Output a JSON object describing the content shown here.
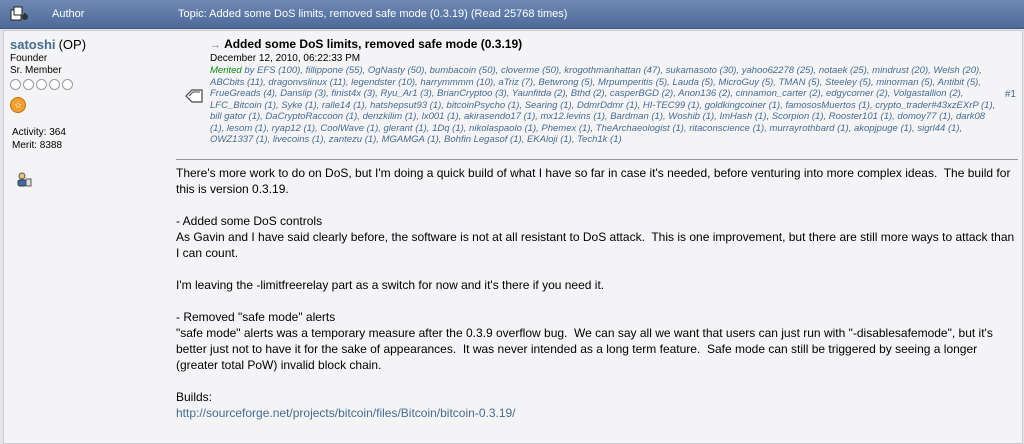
{
  "header": {
    "author_label": "Author",
    "topic_text": "Topic: Added some DoS limits, removed safe mode (0.3.19)  (Read 25768 times)"
  },
  "poster": {
    "name": "satoshi",
    "op": "(OP)",
    "title": "Founder",
    "rank": "Sr. Member",
    "activity": "Activity: 364",
    "merit": "Merit: 8388",
    "badge": "☆"
  },
  "post": {
    "arrow": "→",
    "subject": "Added some DoS limits, removed safe mode (0.3.19)",
    "date": "December 12, 2010, 06:22:33 PM",
    "merited_label": "Merited",
    "merited_by": " by EFS (100), fillippone (55), OgNasty (50), bumbacoin (50), cloverme (50), krogothmanhattan (47), sukamasoto (30), yahoo62278 (25), notaek (25), mindrust (20), Welsh (20), ABCbits (11), dragonvslinux (11), legendster (10), harrymmmm (10), aTriz (7), Betwrong (5), Mrpumperitis (5), Lauda (5), MicroGuy (5), TMAN (5), Steeley (5), minorman (5), Antibit (5), FrueGreads (4), Danslip (3), finist4x (3), Ryu_Ar1 (3), BrianCryptoo (3), Yaunfitda (2), Bthd (2), casperBGD (2), Anon136 (2), cinnamon_carter (2), edgycorner (2), Volgastallion (2), LFC_Bitcoin (1), Syke (1), ralle14 (1), hatshepsut93 (1), bitcoinPsycho (1), Searing (1), DdmrDdmr (1), HI-TEC99 (1), goldkingcoiner (1), famososMuertos (1), crypto_trader#43xzEXrP (1), bill gator (1), DaCryptoRaccoon (1), denzkilim (1), lx001 (1), akirasendo17 (1), mx12.levins (1), Bardman (1), Woshib (1), ImHash (1), Scorpion (1), Rooster101 (1), domoy77 (1), dark08 (1), lesom (1), ryap12 (1), CoolWave (1), glerant (1), 1Dq (1), nikolaspaolo (1), Phemex (1), TheArchaeologist (1), ritaconscience (1), murrayrothbard (1), akopjpuge (1), sigrl44 (1), OWZ1337 (1), livecoins (1), zantezu (1), MGAMGA (1), Bohfin Legasof (1), EKAloji (1), Tech1k (1)",
    "number": "#1",
    "paragraphs": [
      "There's more work to do on DoS, but I'm doing a quick build of what I have so far in case it's needed, before venturing into more complex ideas.  The build for this is version 0.3.19.",
      "- Added some DoS controls\nAs Gavin and I have said clearly before, the software is not at all resistant to DoS attack.  This is one improvement, but there are still more ways to attack than I can count.",
      "I'm leaving the -limitfreerelay part as a switch for now and it's there if you need it.",
      "- Removed \"safe mode\" alerts\n\"safe mode\" alerts was a temporary measure after the 0.3.9 overflow bug.  We can say all we want that users can just run with \"-disablesafemode\", but it's better just not to have it for the sake of appearances.  It was never intended as a long term feature.  Safe mode can still be triggered by seeing a longer (greater total PoW) invalid block chain."
    ],
    "builds_label": "Builds:",
    "builds_link": "http://sourceforge.net/projects/bitcoin/files/Bitcoin/bitcoin-0.3.19/"
  }
}
